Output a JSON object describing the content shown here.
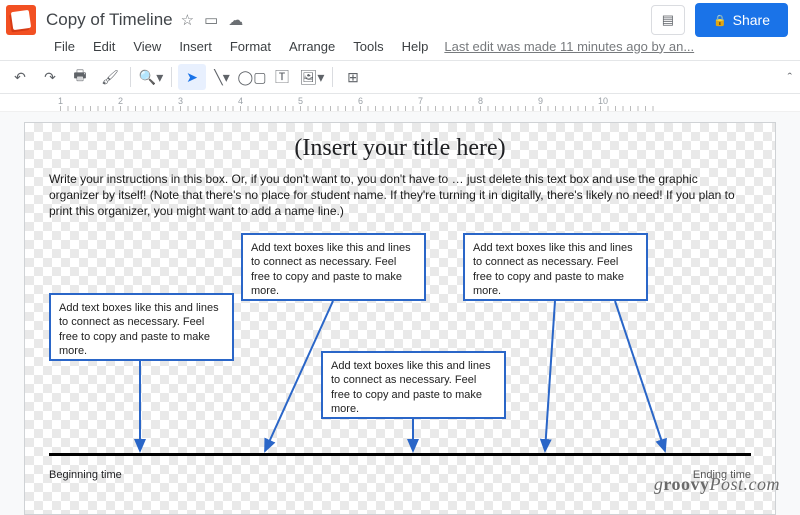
{
  "header": {
    "doc_title": "Copy of Timeline",
    "share_label": "Share",
    "last_edit": "Last edit was made 11 minutes ago by an..."
  },
  "menu": {
    "file": "File",
    "edit": "Edit",
    "view": "View",
    "insert": "Insert",
    "format": "Format",
    "arrange": "Arrange",
    "tools": "Tools",
    "help": "Help"
  },
  "ruler": {
    "ticks": [
      "1",
      "2",
      "3",
      "4",
      "5",
      "6",
      "7",
      "8",
      "9",
      "10"
    ]
  },
  "slide": {
    "title": "(Insert your title here)",
    "instructions": "Write your instructions in this box. Or, if you don't want to, you don't have to … just delete this text box and use the graphic organizer by itself! (Note that there's no place for student name. If they're turning it in digitally, there's likely no need! If you plan to print this organizer, you might want to add a name line.)",
    "box_text": "Add text boxes like this and lines to connect as necessary. Feel free to copy and paste to make more.",
    "begin_label": "Beginning time",
    "end_label": "Ending time"
  },
  "watermark": "groovyPost.com"
}
